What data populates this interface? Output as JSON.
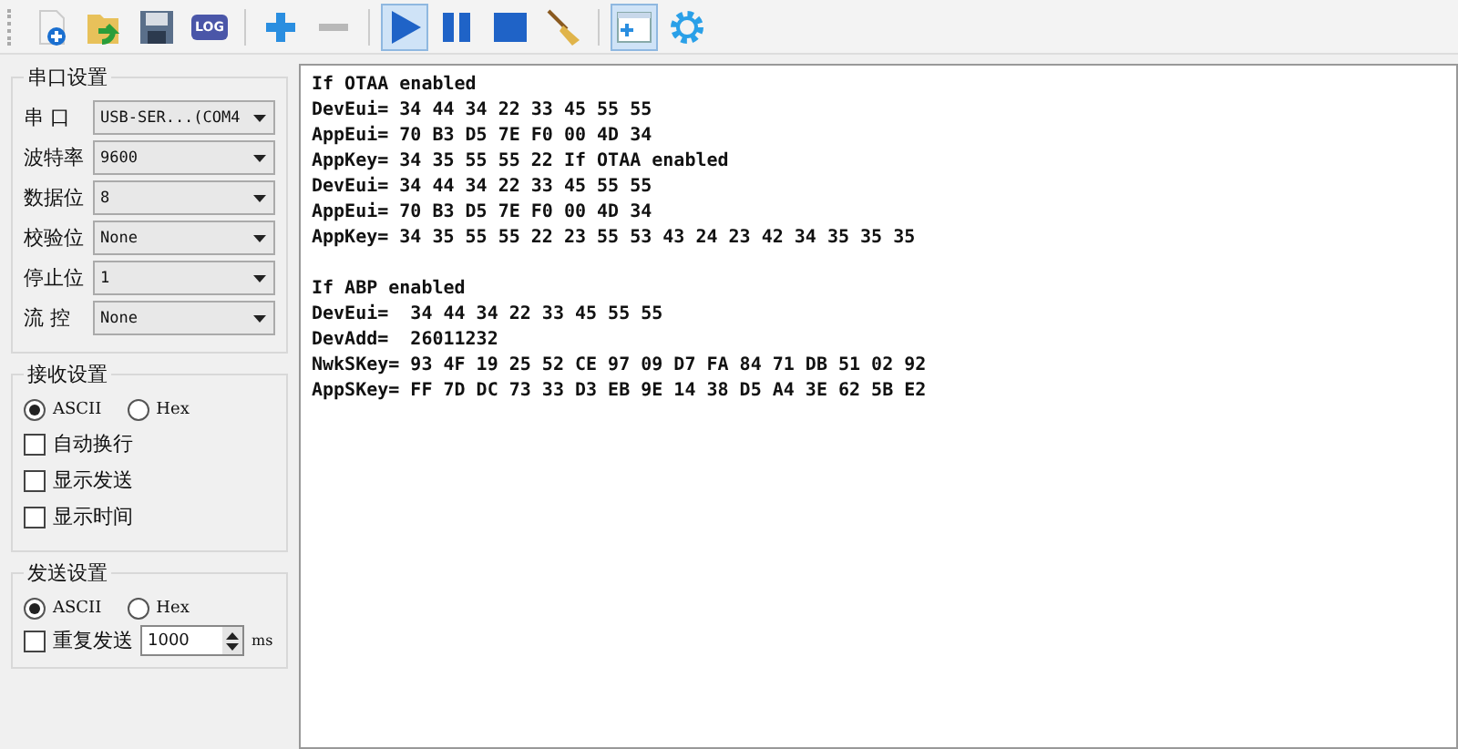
{
  "toolbar": [
    {
      "kind": "new",
      "selected": false
    },
    {
      "kind": "open",
      "selected": false
    },
    {
      "kind": "save",
      "selected": false
    },
    {
      "kind": "log",
      "label": "LOG",
      "selected": false
    },
    {
      "kind": "sep"
    },
    {
      "kind": "plus",
      "selected": false
    },
    {
      "kind": "minus",
      "selected": false
    },
    {
      "kind": "sep"
    },
    {
      "kind": "play",
      "selected": true
    },
    {
      "kind": "pause",
      "selected": false
    },
    {
      "kind": "stop",
      "selected": false
    },
    {
      "kind": "broom",
      "selected": false
    },
    {
      "kind": "sep"
    },
    {
      "kind": "window",
      "selected": true
    },
    {
      "kind": "gear",
      "selected": false
    }
  ],
  "serial": {
    "title": "串口设置",
    "fields": [
      {
        "label": "串 口",
        "value": "USB-SER...(COM4"
      },
      {
        "label": "波特率",
        "value": "9600"
      },
      {
        "label": "数据位",
        "value": "8"
      },
      {
        "label": "校验位",
        "value": "None"
      },
      {
        "label": "停止位",
        "value": "1"
      },
      {
        "label": "流 控",
        "value": "None"
      }
    ]
  },
  "receive": {
    "title": "接收设置",
    "radios": [
      {
        "label": "ASCII",
        "selected": true
      },
      {
        "label": "Hex",
        "selected": false
      }
    ],
    "checkboxes": [
      {
        "label": "自动换行",
        "checked": false
      },
      {
        "label": "显示发送",
        "checked": false
      },
      {
        "label": "显示时间",
        "checked": false
      }
    ]
  },
  "send": {
    "title": "发送设置",
    "radios": [
      {
        "label": "ASCII",
        "selected": true
      },
      {
        "label": "Hex",
        "selected": false
      }
    ],
    "repeat": {
      "label": "重复发送",
      "checked": false
    },
    "interval": "1000",
    "unit": "ms"
  },
  "output": [
    [
      "If OTAA enabled",
      "DevEui= 34 44 34 22 33 45 55 55",
      "AppEui= 70 B3 D5 7E F0 00 4D 34",
      "AppKey= 34 35 55 55 22 If OTAA enabled",
      "DevEui= 34 44 34 22 33 45 55 55",
      "AppEui= 70 B3 D5 7E F0 00 4D 34",
      "AppKey= 34 35 55 55 22 23 55 53 43 24 23 42 34 35 35 35"
    ],
    [
      "If ABP enabled",
      "DevEui=  34 44 34 22 33 45 55 55",
      "DevAdd=  26011232",
      "NwkSKey= 93 4F 19 25 52 CE 97 09 D7 FA 84 71 DB 51 02 92",
      "AppSKey= FF 7D DC 73 33 D3 EB 9E 14 38 D5 A4 3E 62 5B E2"
    ]
  ]
}
